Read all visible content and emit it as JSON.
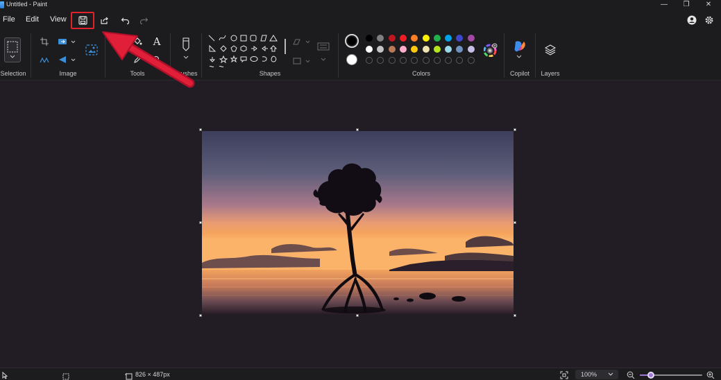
{
  "window": {
    "title": "Untitled - Paint",
    "minimize_glyph": "—",
    "maximize_glyph": "❐",
    "close_glyph": "✕"
  },
  "menu": {
    "file": "File",
    "edit": "Edit",
    "view": "View"
  },
  "quick_access": {
    "save_icon": "save-icon",
    "share_icon": "share-icon",
    "undo_icon": "undo-icon",
    "redo_icon": "redo-icon",
    "highlight_color": "#e2232b"
  },
  "ribbon": {
    "groups": {
      "selection": "Selection",
      "image": "Image",
      "tools": "Tools",
      "brushes": "Brushes",
      "shapes": "Shapes",
      "colors": "Colors",
      "copilot": "Copilot",
      "layers": "Layers"
    },
    "tools_text_glyph": "A",
    "colors": {
      "primary": "#000000",
      "secondary": "#ffffff",
      "row1": [
        "#000000",
        "#7f7f7f",
        "#c0161f",
        "#ee1c24",
        "#ff7f27",
        "#fff200",
        "#22b14c",
        "#00a2e8",
        "#3f48cc",
        "#a349a4"
      ],
      "row2": [
        "#ffffff",
        "#c3c3c3",
        "#b97a57",
        "#ffaec9",
        "#ffc90e",
        "#efe4b0",
        "#b5e61d",
        "#99d9ea",
        "#7092be",
        "#c8bfe7"
      ]
    }
  },
  "status": {
    "canvas_size": "826 × 487px",
    "zoom": "100%",
    "zoom_slider_level_percent": 18
  }
}
